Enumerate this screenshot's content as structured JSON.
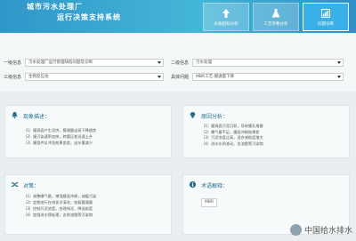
{
  "header": {
    "title_top": "城市污水处理厂",
    "title_bottom": "运行决策支持系统",
    "tabs": [
      {
        "label": "水质超标分析",
        "icon": "upload-icon",
        "active": false
      },
      {
        "label": "工艺参数分析",
        "icon": "flask-icon",
        "active": false
      },
      {
        "label": "问题诊断",
        "icon": "chart-icon",
        "active": true
      }
    ]
  },
  "form": {
    "level1_label": "一级信息",
    "level1_value": "污水处理厂运行管理缺陷问题及诊断",
    "level2_label": "二级信息",
    "level2_value": "污水处理",
    "level3_label": "三级信息",
    "level3_value": "生物反应池",
    "specific_label": "具体问题",
    "specific_value": "MBR工艺:膜通量下降"
  },
  "panels": {
    "phenomenon": {
      "title": "现象描述：",
      "lines": [
        "（1）膜表面产生泥饼，膜通量出现下降趋势",
        "（2）膜污染速率加快，跨膜压差迅速上升",
        "（3）膜组件反冲洗效果变差，出水量减少"
      ]
    },
    "cause": {
      "title": "原因分析：",
      "lines": [
        "（1）膜表面污泥沉积，导致膜孔堵塞",
        "（2）曝气量不足，膜面冲刷效果差",
        "（3）污泥浓度过高，混合液粘度增大",
        "（4）进水水质波动，含油脂等污染物"
      ]
    },
    "measures": {
      "title": "对策：",
      "lines": [
        "（1）调整曝气量，增强膜面冲刷，减缓污染",
        "（2）定期进行在线化学清洗，恢复膜通量",
        "（3）控制污泥浓度，合理排泥，降低粘度",
        "（4）加强进水预处理，去除油脂等污染物"
      ]
    },
    "terms": {
      "title": "术语解释：",
      "tag": "MBR"
    }
  },
  "watermark": {
    "text": "中国给水排水"
  }
}
